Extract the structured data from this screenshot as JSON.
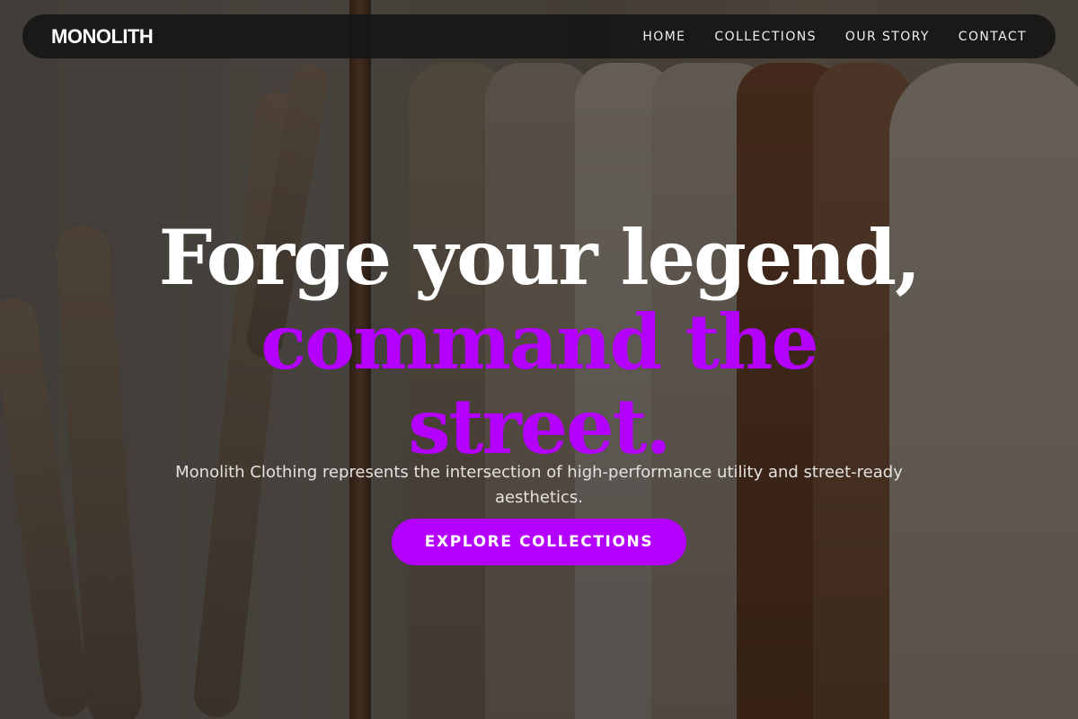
{
  "brand": {
    "name": "MONOLITH",
    "accent_color": "#b400ff"
  },
  "nav": {
    "links": [
      {
        "label": "HOME"
      },
      {
        "label": "COLLECTIONS"
      },
      {
        "label": "OUR STORY"
      },
      {
        "label": "CONTACT"
      }
    ]
  },
  "hero": {
    "headline_line1": "Forge your legend,",
    "headline_line2": "command the",
    "headline_line3": "street.",
    "subtitle": "Monolith Clothing represents the intersection of high-performance utility and street-ready aesthetics.",
    "cta_label": "EXPLORE COLLECTIONS"
  }
}
